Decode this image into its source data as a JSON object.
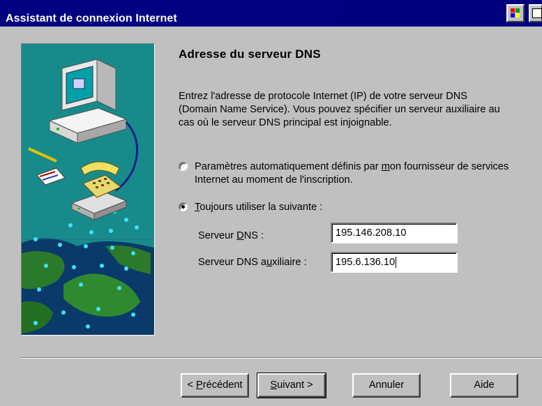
{
  "window": {
    "title": "Assistant de connexion Internet"
  },
  "page": {
    "heading": "Adresse du serveur DNS",
    "description": "Entrez l'adresse de protocole Internet (IP) de votre serveur DNS (Domain Name Service).  Vous pouvez spécifier un serveur auxiliaire au cas où le serveur DNS principal est injoignable."
  },
  "options": {
    "auto": {
      "label_pre": "Paramètres  automatiquement définis par ",
      "label_u": "m",
      "label_post": "on fournisseur de services Internet au moment de l'inscription.",
      "selected": false
    },
    "manual": {
      "label_u": "T",
      "label_post": "oujours utiliser la suivante :",
      "selected": true
    }
  },
  "fields": {
    "dns_primary": {
      "label_pre": "Serveur ",
      "label_u": "D",
      "label_post": "NS :",
      "value": "195.146.208.10"
    },
    "dns_secondary": {
      "label_pre": "Serveur DNS a",
      "label_u": "u",
      "label_post": "xiliaire :",
      "value": "195.6.136.10"
    }
  },
  "buttons": {
    "back": {
      "pre": "< ",
      "u": "P",
      "post": "récédent"
    },
    "next": {
      "u": "S",
      "post": "uivant >"
    },
    "cancel": "Annuler",
    "help": "Aide"
  },
  "icons": [
    "window-tile-icon",
    "window-app-icon",
    "computer-icon",
    "telephone-icon",
    "network-globe-icon"
  ],
  "colors": {
    "title_bg": "#000080",
    "face": "#c0c0c0",
    "illus_bg": "#1a8a8c"
  }
}
